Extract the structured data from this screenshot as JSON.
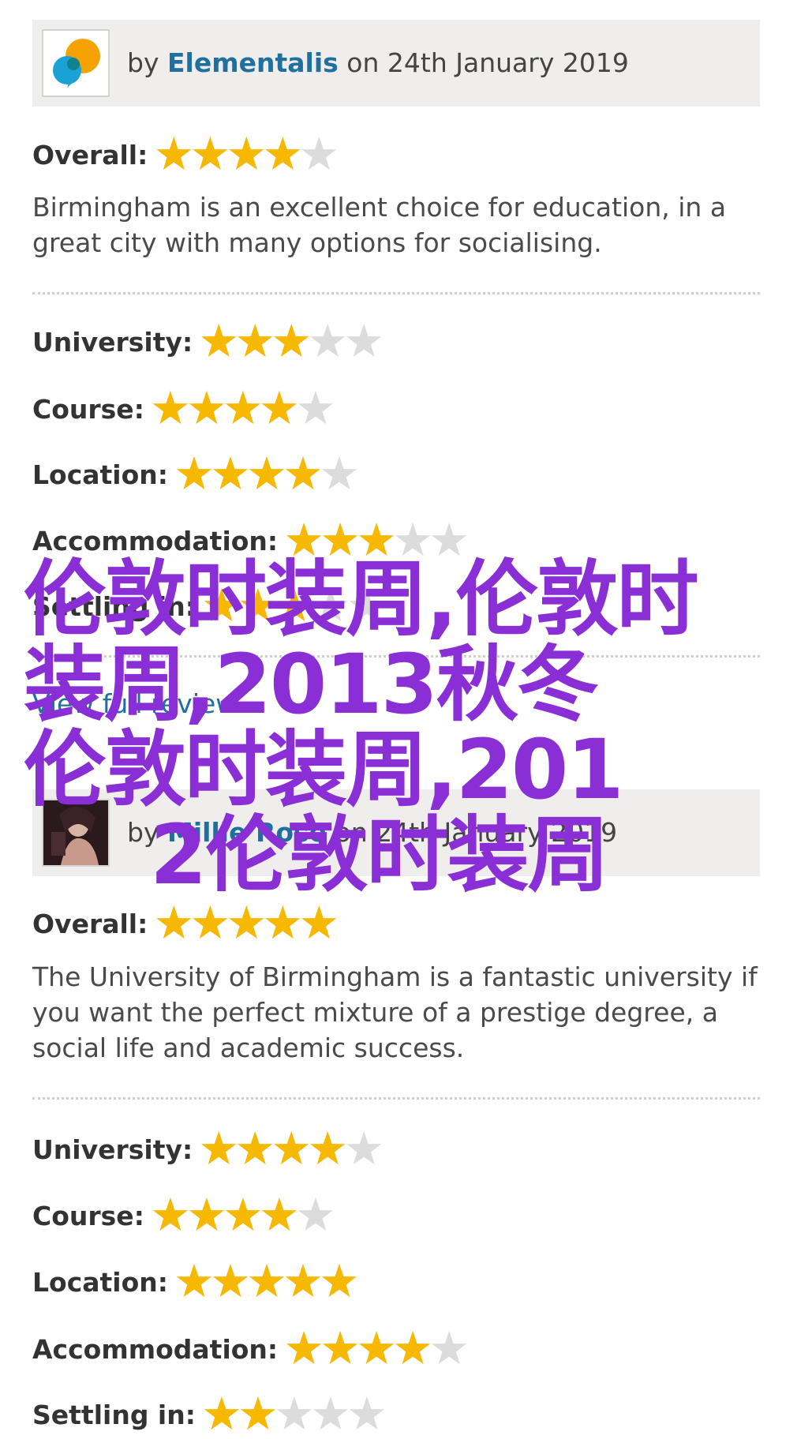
{
  "colors": {
    "star_on": "#f6b800",
    "star_off": "#dcdcdc",
    "author_link": "#1f6f9f",
    "overlay_text": "#8a2ed6",
    "header_bg": "#efeeec"
  },
  "reviews": [
    {
      "by": "by",
      "author": "Elementalis",
      "on": "on",
      "date": "24th January 2019",
      "avatar_icon": "blue-orange-bubble-logo",
      "overall": {
        "label": "Overall",
        "stars": 4,
        "max": 5
      },
      "comment": "Birmingham is an excellent choice for education, in a great city with many options for socialising.",
      "ratings": [
        {
          "label": "University",
          "stars": 3,
          "max": 5
        },
        {
          "label": "Course",
          "stars": 4,
          "max": 5
        },
        {
          "label": "Location",
          "stars": 4,
          "max": 5
        },
        {
          "label": "Accommodation",
          "stars": 3,
          "max": 5
        },
        {
          "label": "Settling in",
          "stars": 3,
          "max": 5
        }
      ],
      "view_full_review": "View full review"
    },
    {
      "by": "by",
      "author": "Millie Rose",
      "on": "on",
      "date": "24th January 2019",
      "avatar_icon": "user-photo-avatar",
      "overall": {
        "label": "Overall",
        "stars": 5,
        "max": 5
      },
      "comment": "The University of Birmingham is a fantastic university if you want the perfect mixture of a prestige degree, a social life and academic success.",
      "ratings": [
        {
          "label": "University",
          "stars": 4,
          "max": 5
        },
        {
          "label": "Course",
          "stars": 4,
          "max": 5
        },
        {
          "label": "Location",
          "stars": 5,
          "max": 5
        },
        {
          "label": "Accommodation",
          "stars": 4,
          "max": 5
        },
        {
          "label": "Settling in",
          "stars": 2,
          "max": 5
        }
      ]
    }
  ],
  "overlay": {
    "line1": "伦敦时装周,伦敦时",
    "line2": "装周,2013秋冬",
    "line3": "伦敦时装周,201",
    "line4": "2伦敦时装周"
  }
}
